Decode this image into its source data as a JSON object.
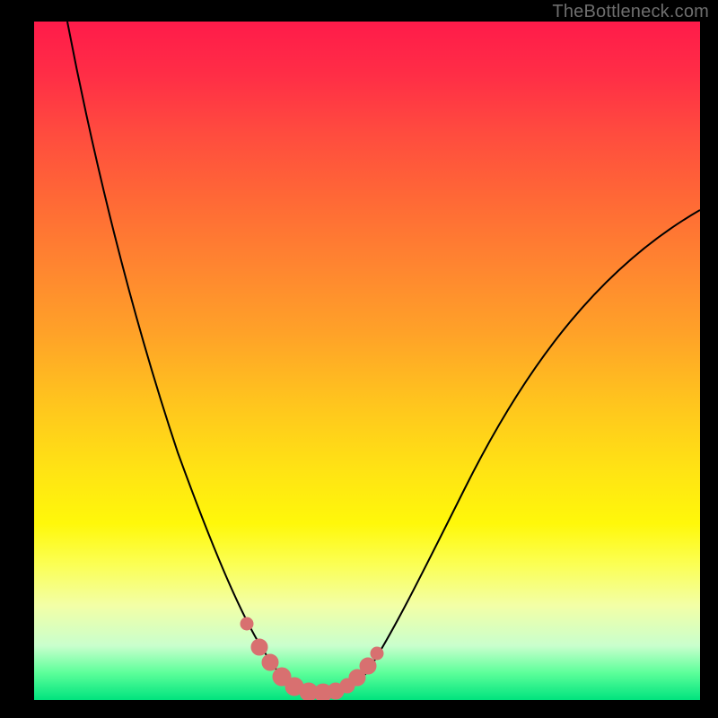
{
  "watermark": {
    "text": "TheBottleneck.com"
  },
  "colors": {
    "background": "#000000",
    "curve_stroke": "#000000",
    "marker_fill": "#d87070",
    "watermark": "#6e6e6e"
  },
  "chart_data": {
    "type": "line",
    "title": "",
    "xlabel": "",
    "ylabel": "",
    "xlim": [
      0,
      100
    ],
    "ylim": [
      0,
      100
    ],
    "grid": false,
    "series": [
      {
        "name": "bottleneck-curve",
        "x": [
          5,
          10,
          15,
          20,
          25,
          28,
          30,
          32,
          34,
          35,
          36,
          38,
          40,
          42,
          44,
          46,
          48,
          50,
          55,
          60,
          65,
          70,
          75,
          80,
          85,
          90,
          95,
          100
        ],
        "y": [
          100,
          80,
          62,
          46,
          32,
          24,
          18,
          12,
          7,
          5,
          4,
          3,
          2,
          2,
          2,
          3,
          4,
          6,
          12,
          20,
          28,
          35,
          42,
          48,
          54,
          58,
          62,
          66
        ]
      }
    ],
    "markers": {
      "name": "highlight-points",
      "x": [
        31.5,
        33,
        35,
        37,
        39,
        41,
        43,
        44.5,
        46,
        48,
        49.5
      ],
      "y": [
        12,
        8,
        5,
        3,
        2,
        2,
        2,
        3,
        4,
        6,
        8
      ]
    }
  }
}
